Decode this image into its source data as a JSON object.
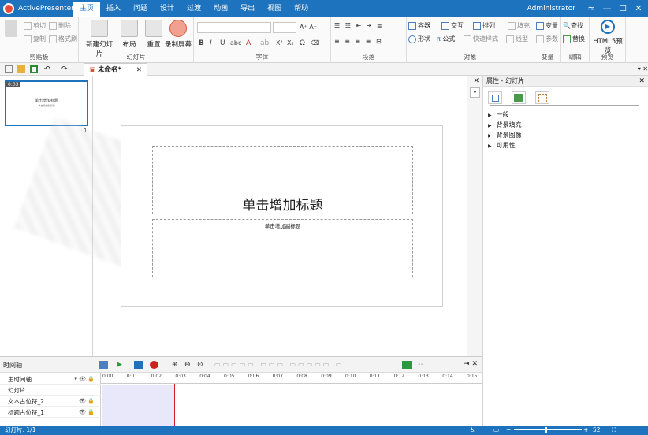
{
  "app": {
    "name": "ActivePresenter",
    "user": "Administrator"
  },
  "menu_tabs": [
    "主页",
    "插入",
    "问题",
    "设计",
    "过渡",
    "动画",
    "导出",
    "视图",
    "帮助"
  ],
  "window_controls": {
    "restore": "≈",
    "minimize": "—",
    "maximize": "☐",
    "close": "✕"
  },
  "ribbon": {
    "clipboard": {
      "label": "剪贴板",
      "cut": "剪切",
      "copy": "复制",
      "delete": "删除",
      "copy_format": "格式刷"
    },
    "slides": {
      "label": "幻灯片",
      "new_slide": "新建幻灯片",
      "layout": "布局",
      "reset": "重置",
      "record_screen": "录制屏幕"
    },
    "font": {
      "label": "字体",
      "bold": "B",
      "italic": "I",
      "underline": "U",
      "strike": "abc"
    },
    "paragraph": {
      "label": "段落"
    },
    "objects": {
      "label": "对象",
      "container": "容器",
      "interaction": "交互",
      "arrange": "排列",
      "shape": "形状",
      "formula": "公式",
      "quick_style": "快速样式",
      "fill": "填充",
      "outline": "线型"
    },
    "variables": {
      "label": "变量",
      "variable": "变量",
      "param": "参数"
    },
    "editing": {
      "label": "编辑",
      "find": "查找",
      "replace": "替换"
    },
    "preview": {
      "label": "预览",
      "html5_preview": "HTML5预览"
    }
  },
  "quick_access": {
    "doc_tab": "未命名*",
    "doc_tab_close": "✕"
  },
  "slide_panel": {
    "thumb_time": "0:03",
    "thumb_title": "单击增加标题",
    "thumb_sub": "单击增加副标题",
    "slide_number": "1"
  },
  "slide": {
    "title_placeholder": "单击增加标题",
    "subtitle_placeholder": "单击增加副标题"
  },
  "properties": {
    "header": "属性 - 幻灯片",
    "sections": [
      "一般",
      "背景填充",
      "背景图像",
      "可用性"
    ]
  },
  "timeline": {
    "title": "时间轴",
    "rows": [
      {
        "label": "主时间轴",
        "icons": "▾ 👁 🔒"
      },
      {
        "label": "幻灯片",
        "icons": ""
      },
      {
        "label": "文本占位符_2",
        "icons": "👁 🔒"
      },
      {
        "label": "标题占位符_1",
        "icons": "👁 🔒"
      }
    ],
    "ticks": [
      "0:00",
      "0:01",
      "0:02",
      "0:03",
      "0:04",
      "0:05",
      "0:06",
      "0:07",
      "0:08",
      "0:09",
      "0:10",
      "0:11",
      "0:12",
      "0:13",
      "0:14",
      "0:15"
    ]
  },
  "status": {
    "text": "幻灯片: 1/1",
    "zoom": "52",
    "zoom_fraction": 0.45
  },
  "colors": {
    "accent": "#1e73be",
    "playhead": "#d02020"
  }
}
